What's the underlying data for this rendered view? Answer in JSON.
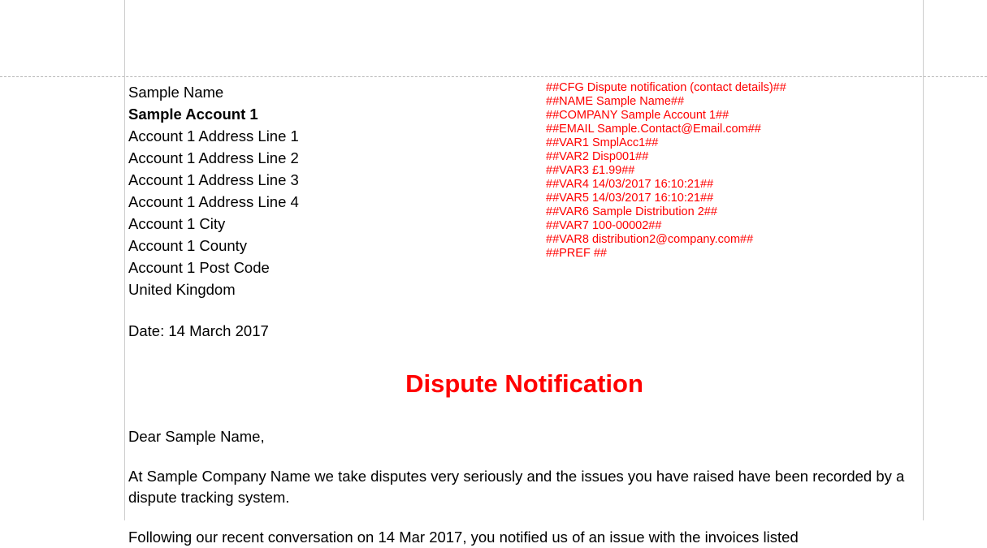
{
  "address": {
    "name": "Sample Name",
    "account": "Sample Account 1",
    "line1": "Account 1 Address Line 1",
    "line2": "Account 1 Address Line 2",
    "line3": "Account 1 Address Line 3",
    "line4": "Account 1 Address Line 4",
    "city": "Account 1 City",
    "county": "Account 1 County",
    "postcode": "Account 1 Post Code",
    "country": "United Kingdom"
  },
  "date_line": "Date:  14 March 2017",
  "vars": {
    "cfg": "##CFG Dispute notification (contact details)##",
    "name": "##NAME Sample Name##",
    "company": "##COMPANY Sample Account 1##",
    "email": "##EMAIL Sample.Contact@Email.com##",
    "var1": "##VAR1 SmplAcc1##",
    "var2": "##VAR2 Disp001##",
    "var3": "##VAR3 £1.99##",
    "var4": "##VAR4 14/03/2017 16:10:21##",
    "var5": "##VAR5 14/03/2017 16:10:21##",
    "var6": "##VAR6 Sample Distribution 2##",
    "var7": "##VAR7 100-00002##",
    "var8": "##VAR8 distribution2@company.com##",
    "pref": "##PREF ##"
  },
  "title": "Dispute Notification",
  "greeting": "Dear Sample Name,",
  "body": {
    "p1": "At Sample Company Name we take disputes very seriously and the issues you have raised have been recorded by a dispute tracking system.",
    "p2": "Following our recent conversation on 14 Mar 2017, you notified us of an issue with the invoices listed"
  }
}
